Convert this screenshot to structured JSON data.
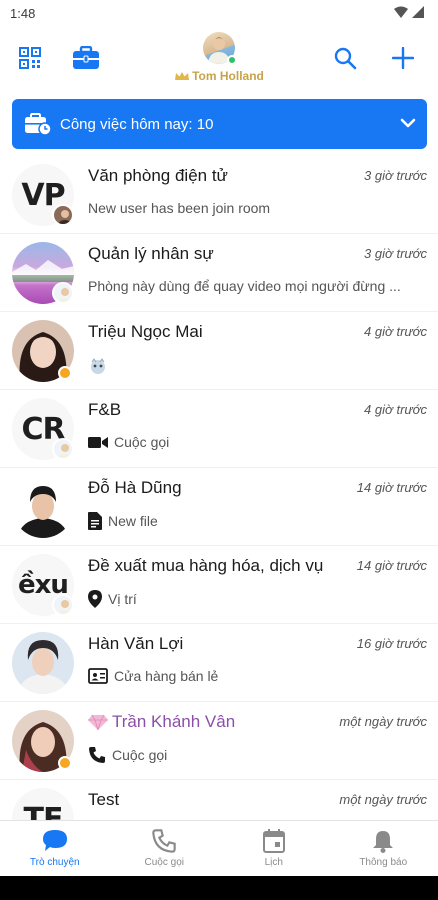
{
  "status_bar": {
    "time": "1:48"
  },
  "header": {
    "profile_name": "Tom Holland",
    "qr_icon": "qr-code-icon",
    "briefcase_icon": "briefcase-icon",
    "search_icon": "search-icon",
    "add_icon": "plus-icon"
  },
  "task_banner": {
    "label": "Công việc hôm nay: 10"
  },
  "conversations": [
    {
      "avatar_text": "VP",
      "name": "Văn phòng điện tử",
      "time": "3 giờ trước",
      "preview": "New user has been join room"
    },
    {
      "name": "Quản lý nhân sự",
      "time": "3 giờ trước",
      "preview": "Phòng này dùng để quay video mọi người đừng ..."
    },
    {
      "name": "Triệu Ngọc Mai",
      "time": "4 giờ trước",
      "preview": ""
    },
    {
      "avatar_text": "CR",
      "name": "F&B",
      "time": "4 giờ trước",
      "preview": "Cuộc gọi"
    },
    {
      "name": "Đỗ Hà Dũng",
      "time": "14 giờ trước",
      "preview": "New file"
    },
    {
      "avatar_text": "ềxu",
      "name": "Đề xuất mua hàng hóa, dịch vụ",
      "time": "14 giờ trước",
      "preview": "Vị trí"
    },
    {
      "name": "Hàn Văn Lợi",
      "time": "16 giờ trước",
      "preview": "Cửa hàng bán lẻ"
    },
    {
      "name": "Trần Khánh Vân",
      "time": "một ngày trước",
      "preview": "Cuộc gọi"
    },
    {
      "avatar_text": "TE",
      "name": "Test",
      "time": "một ngày trước",
      "preview": ""
    }
  ],
  "bottom_nav": [
    {
      "label": "Trò chuyện",
      "active": true
    },
    {
      "label": "Cuộc gọi"
    },
    {
      "label": "Lịch"
    },
    {
      "label": "Thông báo"
    }
  ],
  "colors": {
    "accent": "#1877f2",
    "vip_name": "#8b4fa8",
    "gold": "#c9a34a",
    "online": "#2ec16b",
    "away": "#f5a623"
  }
}
